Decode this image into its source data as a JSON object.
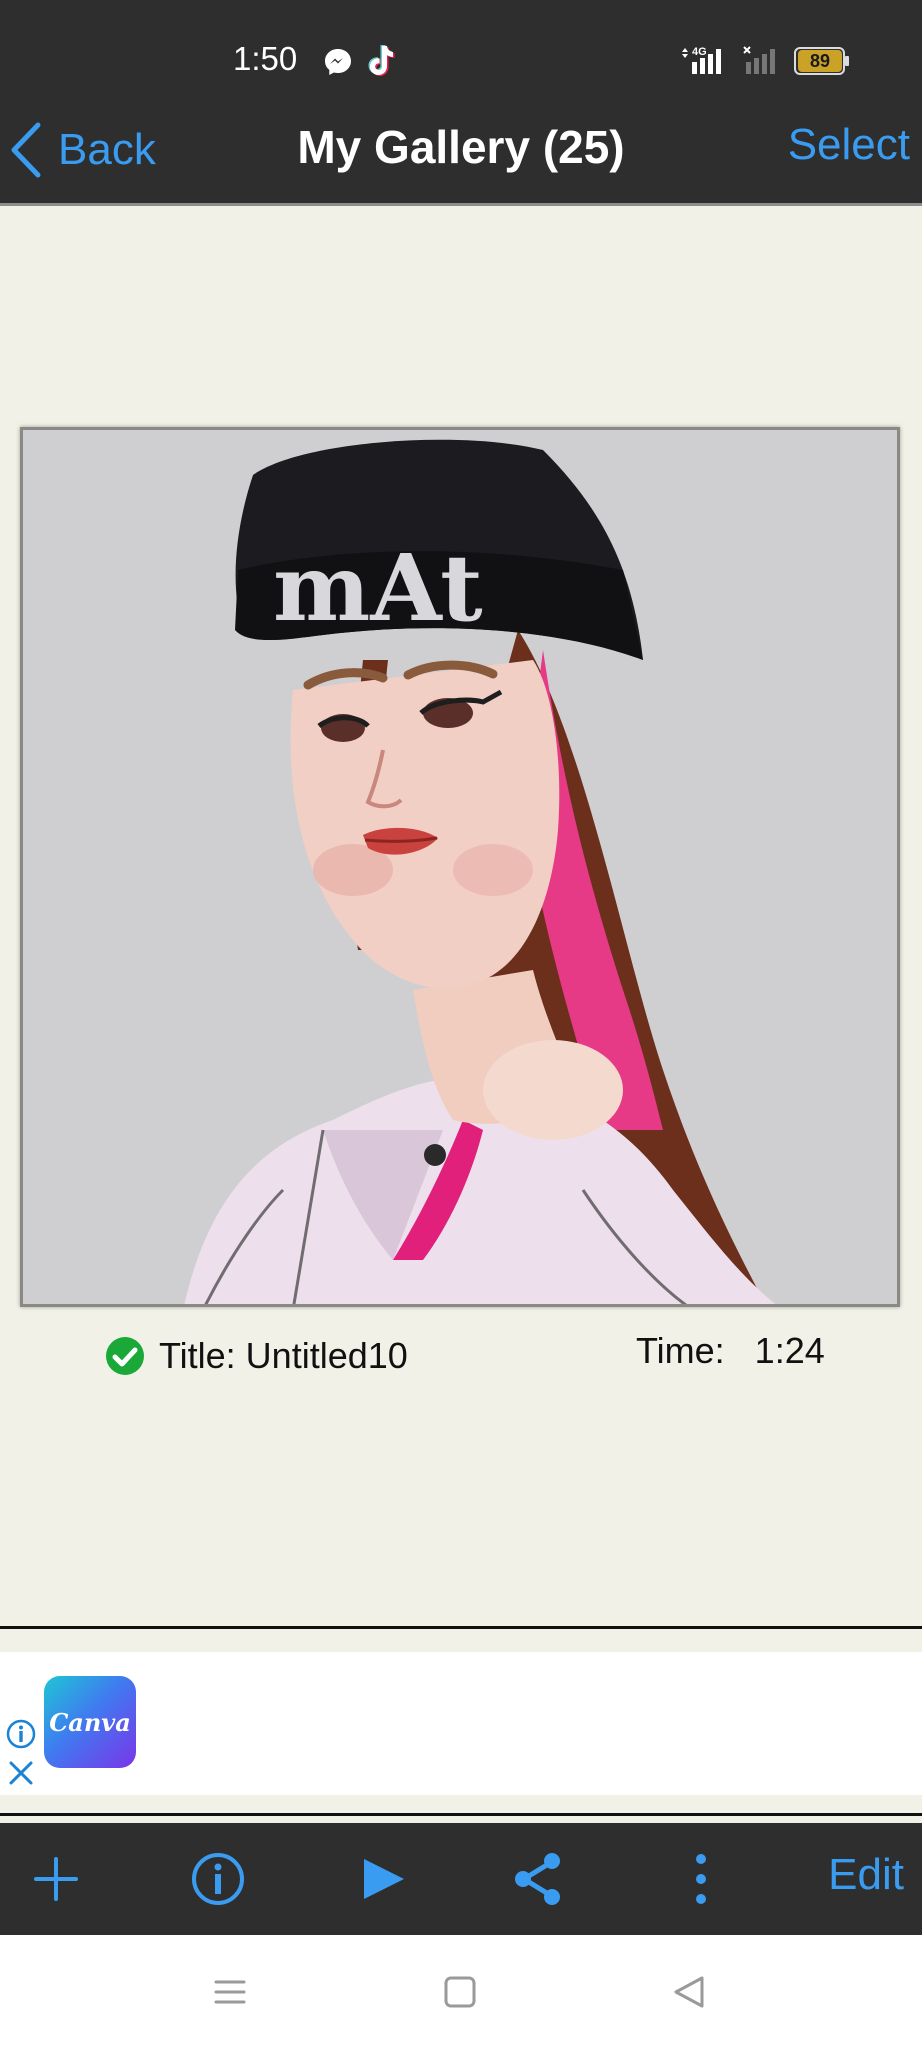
{
  "status_bar": {
    "time": "1:50",
    "network": "4G",
    "battery": "89",
    "icons": [
      "messenger-icon",
      "tiktok-icon",
      "signal-4g-icon",
      "signal-icon",
      "battery-icon"
    ]
  },
  "nav_bar": {
    "back_label": "Back",
    "title": "My Gallery (25)",
    "select_label": "Select"
  },
  "artwork": {
    "title": "Title: Untitled10",
    "time": "Time:   1:24",
    "status_icon": "check-circle-icon",
    "status_color": "#1aa838"
  },
  "ad": {
    "brand": "Canva",
    "icons": [
      "info-icon",
      "close-icon"
    ]
  },
  "toolbar": {
    "items": [
      "add-icon",
      "info-icon",
      "play-icon",
      "share-icon",
      "more-icon"
    ],
    "edit_label": "Edit",
    "accent_color": "#3a9cf0"
  },
  "system_nav": {
    "items": [
      "menu-icon",
      "home-icon",
      "back-triangle-icon"
    ]
  }
}
